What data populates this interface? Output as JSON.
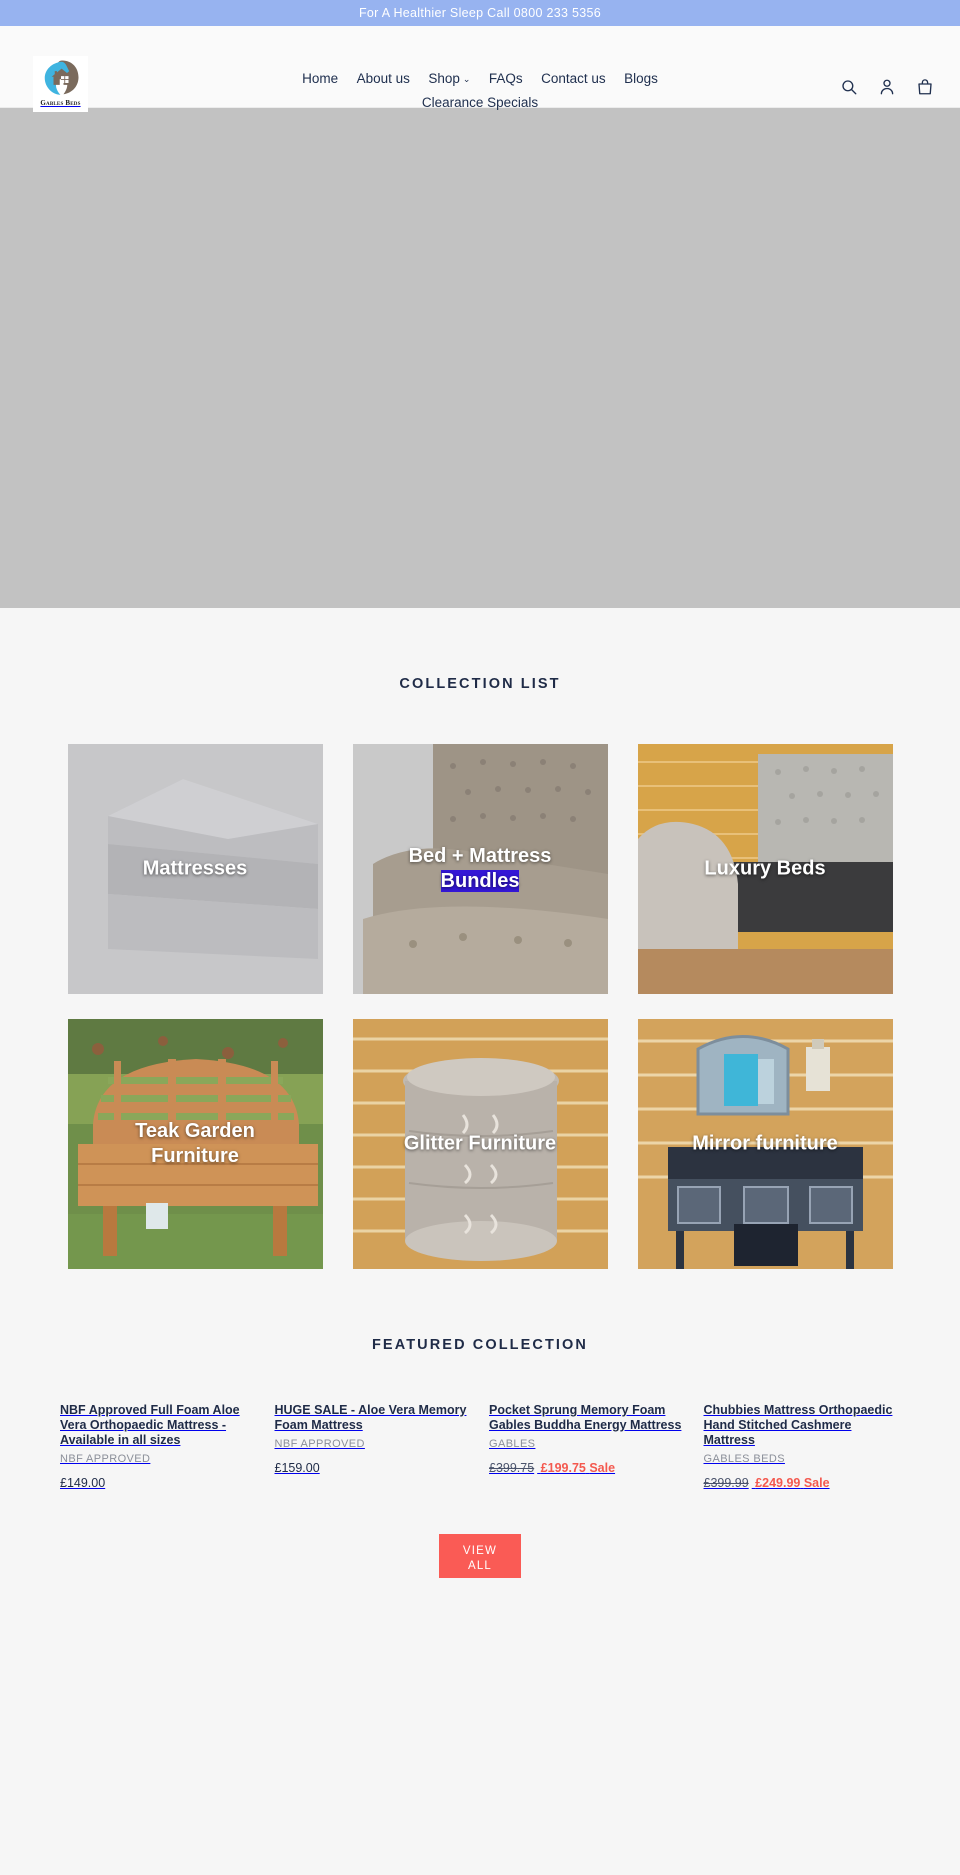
{
  "announcement": {
    "text": "For A Healthier Sleep Call 0800 233 5356"
  },
  "header": {
    "logo_text": "Gables Beds",
    "logo_icon": "gables-beds-house-logo",
    "nav_row1": [
      {
        "label": "Home"
      },
      {
        "label": "About us"
      },
      {
        "label": "Shop",
        "caret": "⌄"
      },
      {
        "label": "FAQs"
      },
      {
        "label": "Contact us"
      },
      {
        "label": "Blogs"
      }
    ],
    "nav_row2": [
      {
        "label": "Clearance Specials"
      }
    ],
    "icons": [
      {
        "name": "search-icon"
      },
      {
        "name": "account-icon"
      },
      {
        "name": "cart-icon"
      }
    ]
  },
  "hero": {
    "placeholder_color": "#c2c2c2"
  },
  "collection_section": {
    "title": "COLLECTION LIST",
    "cards": [
      {
        "label": "Mattresses",
        "image": "grey-foam-mattress-on-grey-background"
      },
      {
        "label_part1": "Bed + Mattress",
        "label_part2": "Bundles",
        "selected_part": "Bundles",
        "image": "beige-tufted-upholstered-bed-and-mattress"
      },
      {
        "label": "Luxury Beds",
        "image": "grey-tufted-sleigh-bed-frame-against-wood-wall"
      },
      {
        "label_part1": "Teak Garden",
        "label_part2": "Furniture",
        "image": "teak-garden-bench-on-grass"
      },
      {
        "label": "Glitter Furniture",
        "image": "silver-glitter-round-bedside-chest"
      },
      {
        "label": "Mirror furniture",
        "image": "mirrored-dressing-table-with-stool"
      }
    ]
  },
  "featured_section": {
    "title": "FEATURED COLLECTION",
    "products": [
      {
        "title": "NBF Approved Full Foam Aloe Vera Orthopaedic Mattress - Available in all sizes",
        "vendor": "NBF APPROVED",
        "price": "£149.00",
        "compare_price": "",
        "sale_label": ""
      },
      {
        "title": "HUGE SALE - Aloe Vera Memory Foam Mattress",
        "vendor": "NBF APPROVED",
        "price": "£159.00",
        "compare_price": "",
        "sale_label": ""
      },
      {
        "title": "Pocket Sprung Memory Foam Gables Buddha Energy Mattress",
        "vendor": "GABLES",
        "price": "£199.75",
        "compare_price": "£399.75",
        "sale_label": "Sale"
      },
      {
        "title": "Chubbies Mattress Orthopaedic Hand Stitched Cashmere Mattress",
        "vendor": "GABLES BEDS",
        "price": "£249.99",
        "compare_price": "£399.99",
        "sale_label": "Sale"
      }
    ],
    "view_all_line1": "VIEW",
    "view_all_line2": "ALL"
  },
  "colors": {
    "announcement_bg": "#97b3f0",
    "accent": "#fa5b55",
    "text": "#1f2b47",
    "page_bg": "#f6f6f6",
    "hero_placeholder": "#c2c2c2"
  }
}
